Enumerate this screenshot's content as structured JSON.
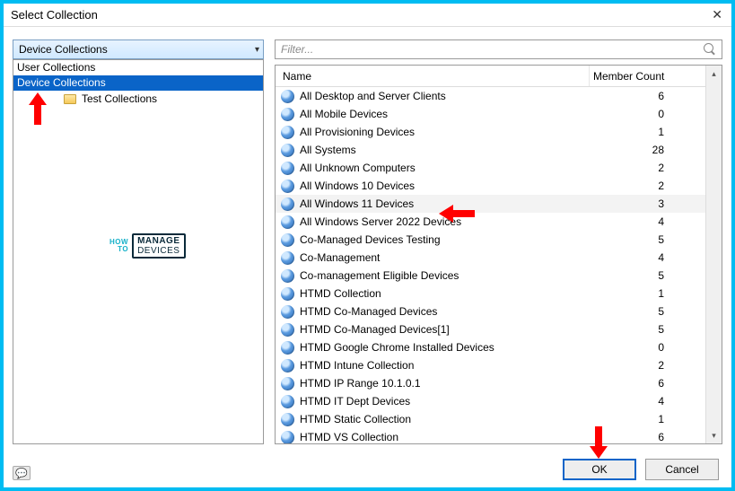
{
  "window": {
    "title": "Select Collection"
  },
  "combo": {
    "value": "Device Collections"
  },
  "tree": {
    "items": [
      {
        "label": "User Collections",
        "selected": false
      },
      {
        "label": "Device Collections",
        "selected": true
      }
    ],
    "child": {
      "label": "Test Collections"
    }
  },
  "filter": {
    "placeholder": "Filter..."
  },
  "grid": {
    "columns": {
      "name": "Name",
      "count": "Member Count"
    },
    "rows": [
      {
        "name": "All Desktop and Server Clients",
        "count": 6
      },
      {
        "name": "All Mobile Devices",
        "count": 0
      },
      {
        "name": "All Provisioning Devices",
        "count": 1
      },
      {
        "name": "All Systems",
        "count": 28
      },
      {
        "name": "All Unknown Computers",
        "count": 2
      },
      {
        "name": "All Windows 10 Devices",
        "count": 2
      },
      {
        "name": "All Windows 11 Devices",
        "count": 3,
        "hover": true
      },
      {
        "name": "All Windows Server 2022 Devices",
        "count": 4
      },
      {
        "name": "Co-Managed Devices Testing",
        "count": 5
      },
      {
        "name": "Co-Management",
        "count": 4
      },
      {
        "name": "Co-management Eligible Devices",
        "count": 5
      },
      {
        "name": "HTMD Collection",
        "count": 1
      },
      {
        "name": "HTMD Co-Managed Devices",
        "count": 5
      },
      {
        "name": "HTMD Co-Managed Devices[1]",
        "count": 5
      },
      {
        "name": "HTMD Google Chrome Installed Devices",
        "count": 0
      },
      {
        "name": "HTMD Intune Collection",
        "count": 2
      },
      {
        "name": "HTMD IP Range 10.1.0.1",
        "count": 6
      },
      {
        "name": "HTMD IT Dept Devices",
        "count": 4
      },
      {
        "name": "HTMD Static Collection",
        "count": 1
      },
      {
        "name": "HTMD VS Collection",
        "count": 6
      }
    ]
  },
  "buttons": {
    "ok": "OK",
    "cancel": "Cancel"
  },
  "watermark": {
    "line1": "HOW",
    "line2": "TO",
    "brand1": "MANAGE",
    "brand2": "DEVICES"
  }
}
